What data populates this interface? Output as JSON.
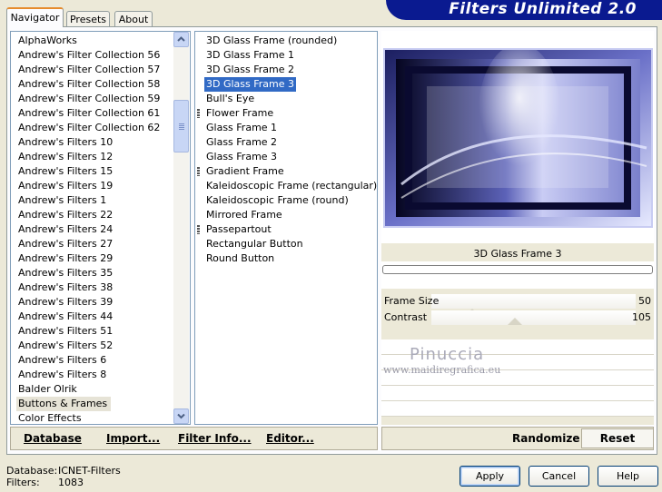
{
  "tabs": [
    {
      "label": "Navigator",
      "active": true
    },
    {
      "label": "Presets",
      "active": false
    },
    {
      "label": "About",
      "active": false
    }
  ],
  "banner_title": "Filters Unlimited 2.0",
  "categories": [
    "AlphaWorks",
    "Andrew's Filter Collection 56",
    "Andrew's Filter Collection 57",
    "Andrew's Filter Collection 58",
    "Andrew's Filter Collection 59",
    "Andrew's Filter Collection 61",
    "Andrew's Filter Collection 62",
    "Andrew's Filters 10",
    "Andrew's Filters 12",
    "Andrew's Filters 15",
    "Andrew's Filters 19",
    "Andrew's Filters 1",
    "Andrew's Filters 22",
    "Andrew's Filters 24",
    "Andrew's Filters 27",
    "Andrew's Filters 29",
    "Andrew's Filters 35",
    "Andrew's Filters 38",
    "Andrew's Filters 39",
    "Andrew's Filters 44",
    "Andrew's Filters 51",
    "Andrew's Filters 52",
    "Andrew's Filters 6",
    "Andrew's Filters 8",
    "Balder Olrik",
    "Buttons & Frames",
    "Color Effects"
  ],
  "selected_category": "Buttons & Frames",
  "filters": [
    {
      "label": "3D Glass Frame (rounded)",
      "marker": false
    },
    {
      "label": "3D Glass Frame 1",
      "marker": false
    },
    {
      "label": "3D Glass Frame 2",
      "marker": false
    },
    {
      "label": "3D Glass Frame 3",
      "marker": false
    },
    {
      "label": "Bull's Eye",
      "marker": false
    },
    {
      "label": "Flower Frame",
      "marker": true
    },
    {
      "label": "Glass Frame 1",
      "marker": false
    },
    {
      "label": "Glass Frame 2",
      "marker": false
    },
    {
      "label": "Glass Frame 3",
      "marker": false
    },
    {
      "label": "Gradient Frame",
      "marker": true
    },
    {
      "label": "Kaleidoscopic Frame (rectangular)",
      "marker": false
    },
    {
      "label": "Kaleidoscopic Frame (round)",
      "marker": false
    },
    {
      "label": "Mirrored Frame",
      "marker": false
    },
    {
      "label": "Passepartout",
      "marker": true
    },
    {
      "label": "Rectangular Button",
      "marker": false
    },
    {
      "label": "Round Button",
      "marker": false
    }
  ],
  "selected_filter": "3D Glass Frame 3",
  "filter_title": "3D Glass Frame 3",
  "params": [
    {
      "label": "Frame Size",
      "value": "50",
      "level": 0.2
    },
    {
      "label": "Contrast",
      "value": "105",
      "level": 0.41
    }
  ],
  "watermark": {
    "name": "Pinuccia",
    "url": "www.maidiregrafica.eu"
  },
  "bottom_links": {
    "database": "Database",
    "import": "Import...",
    "filter_info": "Filter Info...",
    "editor": "Editor..."
  },
  "randomize_label": "Randomize",
  "reset_label": "Reset",
  "status": {
    "database_label": "Database:",
    "database_value": "ICNET-Filters",
    "filters_label": "Filters:",
    "filters_value": "1083"
  },
  "buttons": {
    "apply": "Apply",
    "cancel": "Cancel",
    "help": "Help"
  }
}
